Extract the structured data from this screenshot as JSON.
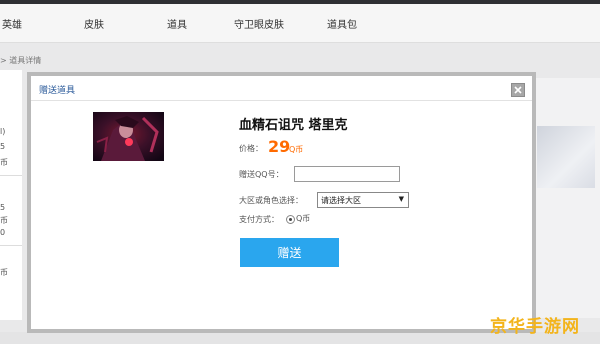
{
  "nav": {
    "items": [
      {
        "label": "英雄"
      },
      {
        "label": "皮肤"
      },
      {
        "label": "道具"
      },
      {
        "label": "守卫眼皮肤"
      },
      {
        "label": "道具包"
      }
    ]
  },
  "breadcrumb": "> 道具详情",
  "side_fragments": [
    "l)",
    "5",
    "币",
    "5",
    "币",
    "0",
    "币"
  ],
  "dialog": {
    "title": "赠送道具",
    "item_name": "血精石诅咒 塔里克",
    "price_label": "价格：",
    "price_value": "29",
    "price_unit": "Q币",
    "qq_label": "赠送QQ号：",
    "qq_value": "",
    "region_label": "大区或角色选择：",
    "region_selected": "请选择大区",
    "pay_label": "支付方式：",
    "pay_option": "Q币",
    "submit_label": "赠送",
    "colors": {
      "accent": "#2aa6ee",
      "price": "#ff6a00",
      "title": "#2a5a9a"
    }
  },
  "watermark": "京华手游网"
}
